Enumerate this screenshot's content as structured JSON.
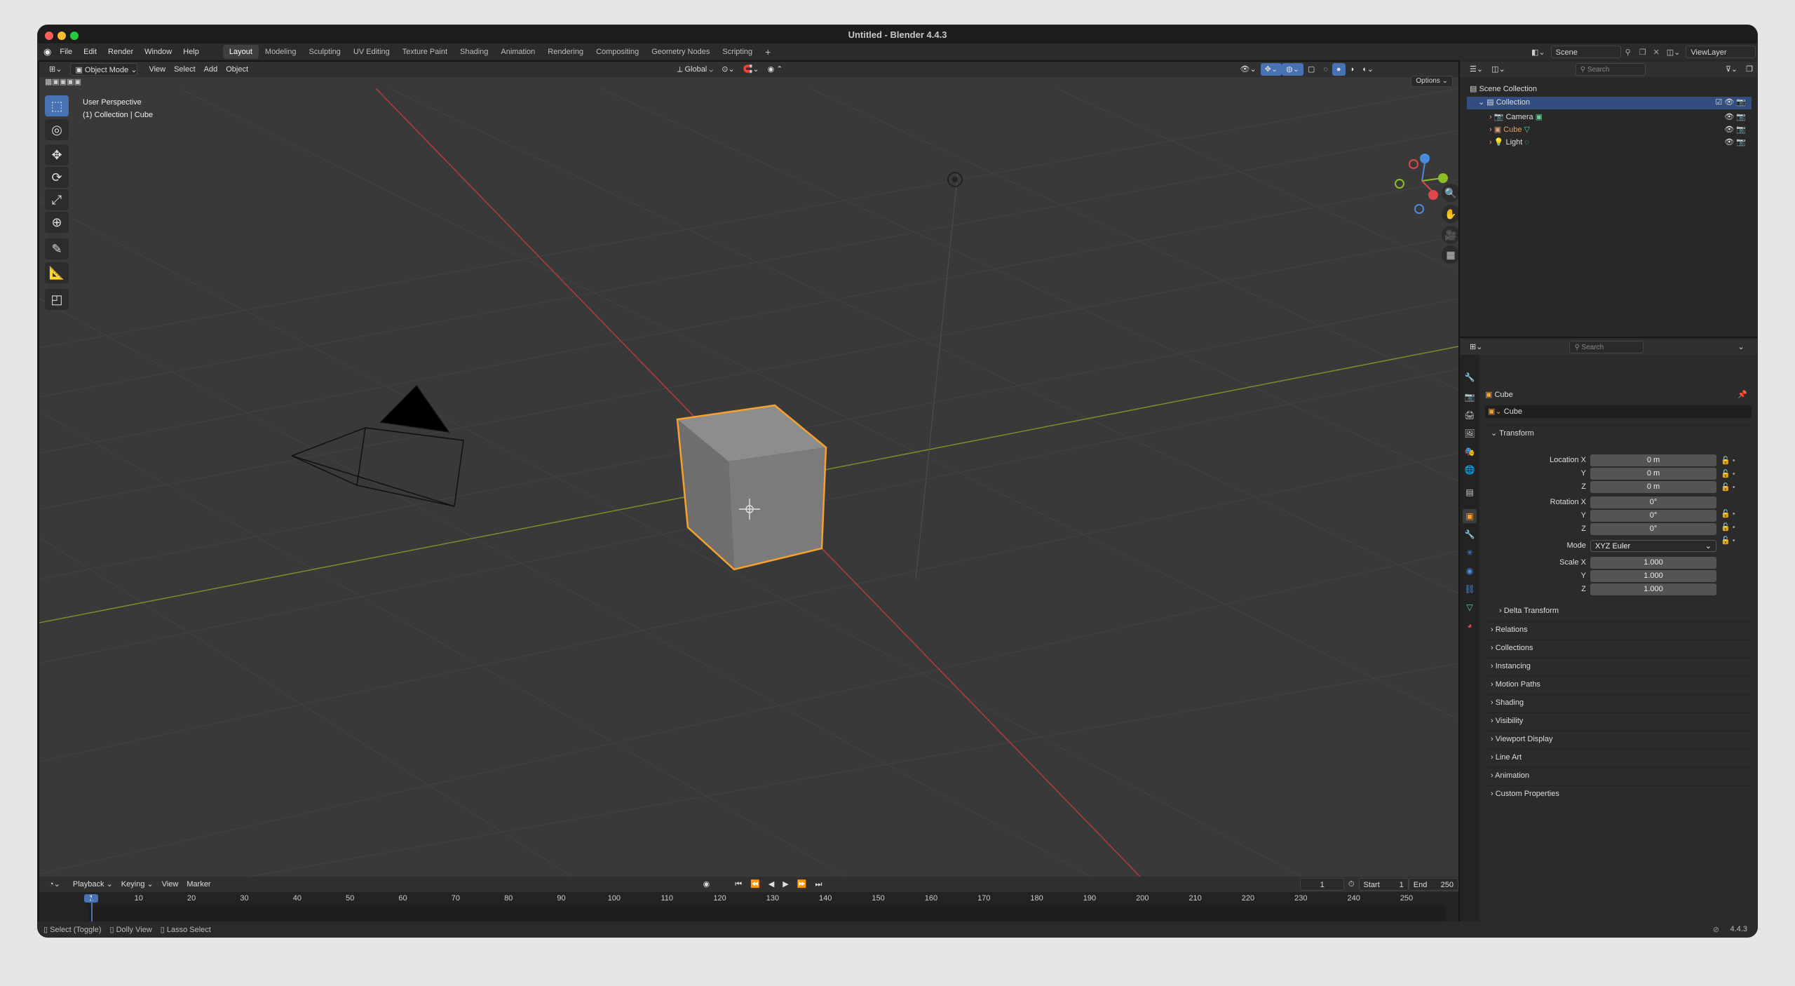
{
  "window": {
    "title": "Untitled - Blender 4.4.3"
  },
  "menu": [
    "File",
    "Edit",
    "Render",
    "Window",
    "Help"
  ],
  "workspaces": [
    "Layout",
    "Modeling",
    "Sculpting",
    "UV Editing",
    "Texture Paint",
    "Shading",
    "Animation",
    "Rendering",
    "Compositing",
    "Geometry Nodes",
    "Scripting"
  ],
  "active_workspace": "Layout",
  "scene": {
    "scene_name": "Scene",
    "view_layer": "ViewLayer"
  },
  "viewport_header": {
    "mode": "Object Mode",
    "menus": [
      "View",
      "Select",
      "Add",
      "Object"
    ],
    "orientation": "Global",
    "options": "Options"
  },
  "viewport": {
    "perspective": "User Perspective",
    "context": "(1) Collection | Cube"
  },
  "outliner": {
    "search_placeholder": "Search",
    "root": "Scene Collection",
    "collection": "Collection",
    "items": [
      "Camera",
      "Cube",
      "Light"
    ]
  },
  "properties": {
    "search_placeholder": "Search",
    "object_name": "Cube",
    "datablock": "Cube",
    "transform_label": "Transform",
    "location_label": "Location X",
    "rotation_label": "Rotation X",
    "scale_label": "Scale X",
    "mode_label": "Mode",
    "mode_value": "XYZ Euler",
    "axis_y": "Y",
    "axis_z": "Z",
    "location": [
      "0 m",
      "0 m",
      "0 m"
    ],
    "rotation": [
      "0°",
      "0°",
      "0°"
    ],
    "scale": [
      "1.000",
      "1.000",
      "1.000"
    ],
    "delta": "Delta Transform",
    "panels": [
      "Relations",
      "Collections",
      "Instancing",
      "Motion Paths",
      "Shading",
      "Visibility",
      "Viewport Display",
      "Line Art",
      "Animation",
      "Custom Properties"
    ]
  },
  "timeline": {
    "menus": [
      "Playback",
      "Keying",
      "View",
      "Marker"
    ],
    "current_frame": "1",
    "start_label": "Start",
    "start": "1",
    "end_label": "End",
    "end": "250",
    "ticks": [
      "1",
      "10",
      "20",
      "30",
      "40",
      "50",
      "60",
      "70",
      "80",
      "90",
      "100",
      "110",
      "120",
      "130",
      "140",
      "150",
      "160",
      "170",
      "180",
      "190",
      "200",
      "210",
      "220",
      "230",
      "240",
      "250"
    ]
  },
  "statusbar": {
    "hints": [
      "Select (Toggle)",
      "Dolly View",
      "Lasso Select"
    ],
    "version": "4.4.3"
  },
  "colors": {
    "selection": "#f5a030",
    "active_tool": "#4772b3",
    "x_axis": "#e0474b",
    "y_axis": "#8cbf26",
    "z_axis": "#4a8be0"
  }
}
